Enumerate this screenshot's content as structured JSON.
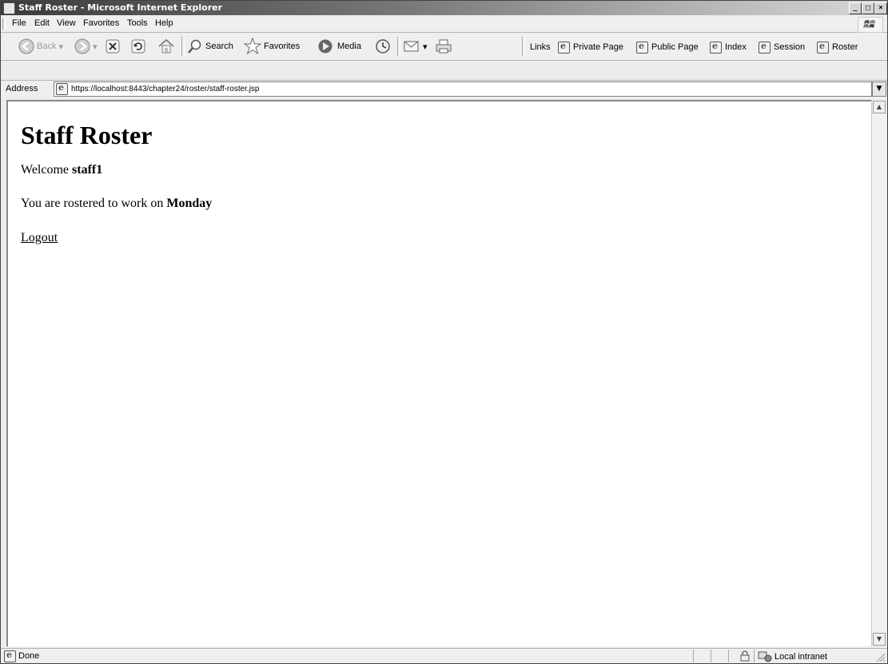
{
  "window": {
    "title": "Staff Roster - Microsoft Internet Explorer",
    "minimize": "_",
    "maximize": "□",
    "close": "×"
  },
  "menu": [
    "File",
    "Edit",
    "View",
    "Favorites",
    "Tools",
    "Help"
  ],
  "toolbar": {
    "back": "Back",
    "search": "Search",
    "favorites": "Favorites",
    "media": "Media"
  },
  "links": {
    "label": "Links",
    "items": [
      "Private Page",
      "Public Page",
      "Index",
      "Session",
      "Roster"
    ]
  },
  "address": {
    "label": "Address",
    "url": "https://localhost:8443/chapter24/roster/staff-roster.jsp"
  },
  "page": {
    "heading": "Staff Roster",
    "welcome_prefix": "Welcome ",
    "user": "staff1",
    "roster_prefix": "You are rostered to work on ",
    "day": "Monday",
    "logout": "Logout"
  },
  "status": {
    "text": "Done",
    "zone": "Local intranet"
  }
}
